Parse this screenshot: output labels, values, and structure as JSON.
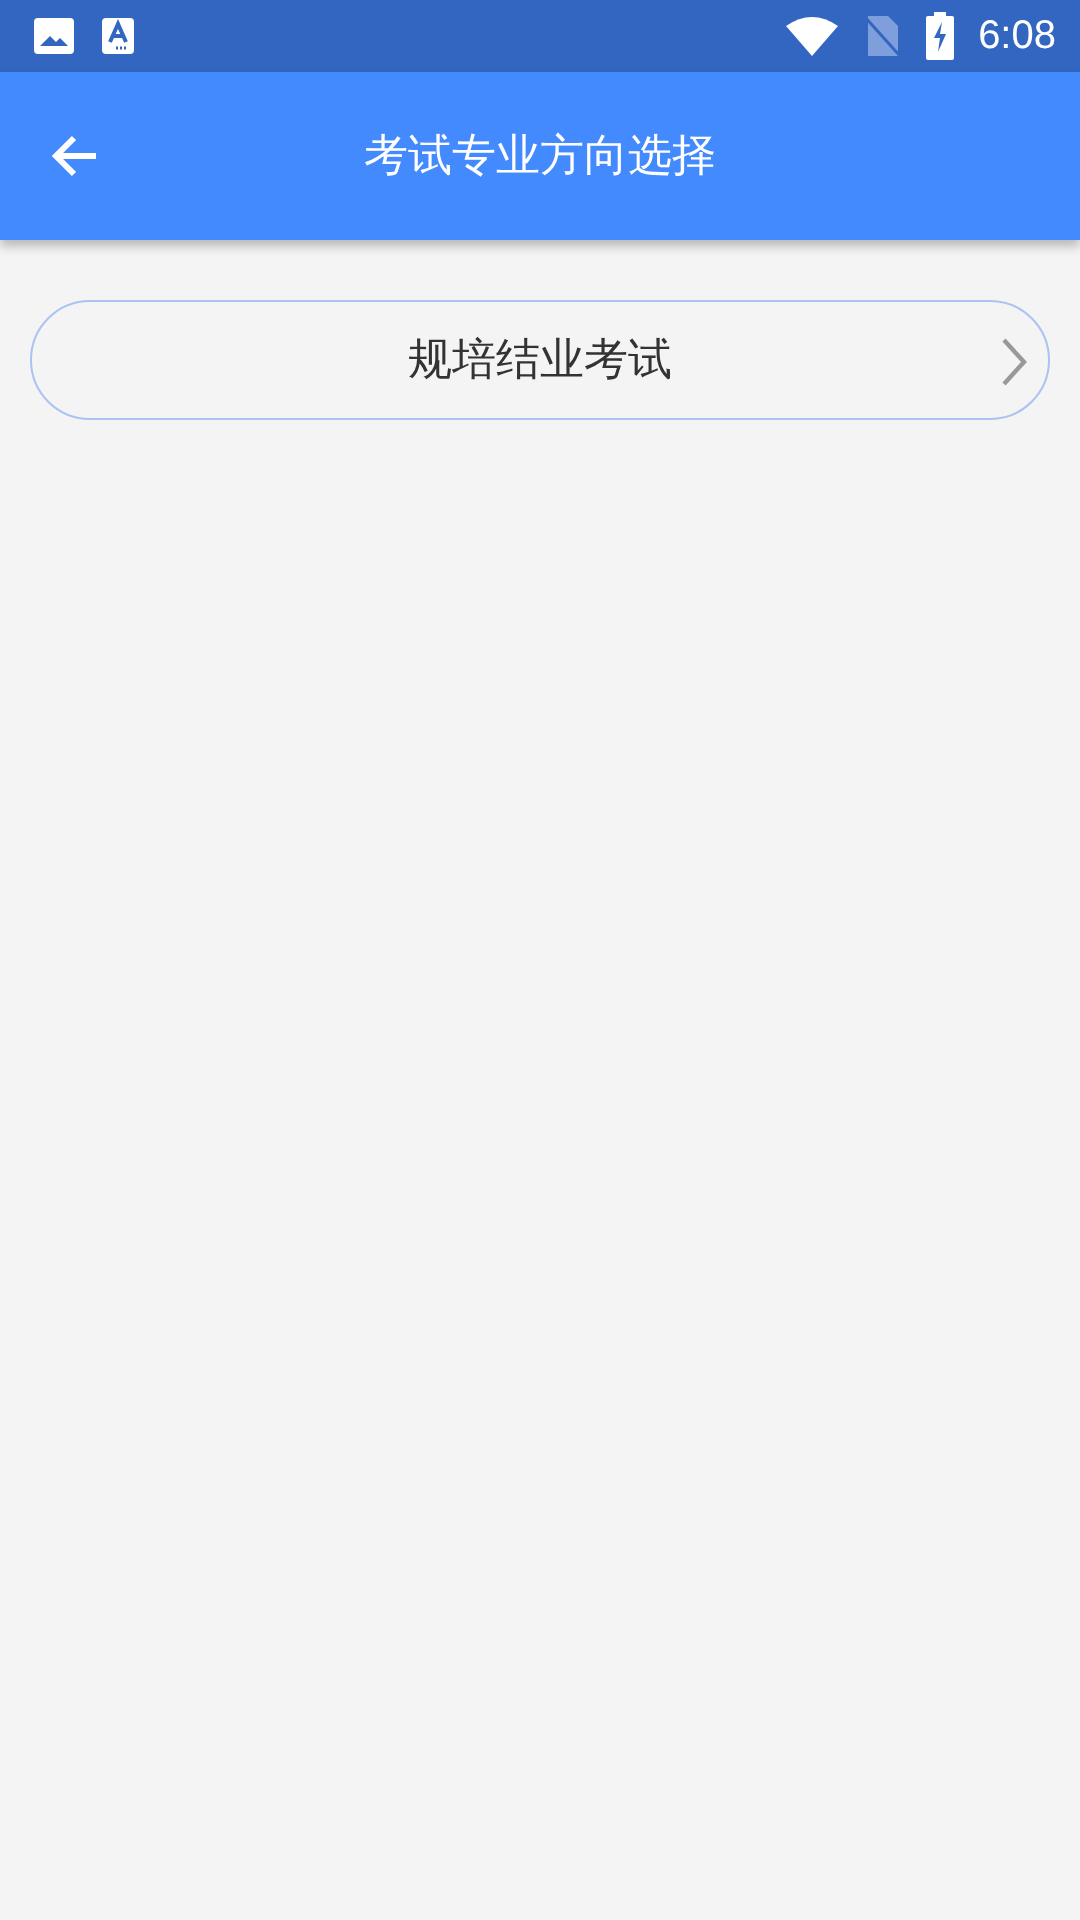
{
  "status_bar": {
    "time": "6:08"
  },
  "app_bar": {
    "title": "考试专业方向选择"
  },
  "options": [
    {
      "label": "规培结业考试"
    }
  ]
}
